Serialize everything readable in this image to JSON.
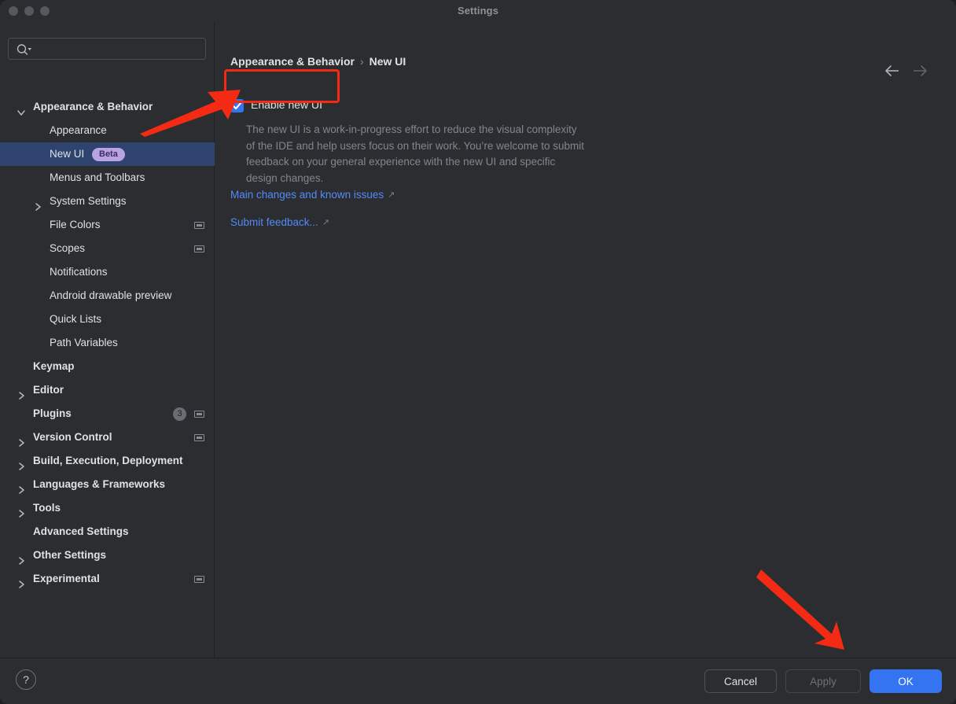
{
  "window": {
    "title": "Settings",
    "traffic_lights": [
      "close",
      "minimize",
      "maximize"
    ]
  },
  "search": {
    "value": "",
    "placeholder": "",
    "icon": "search-icon-with-dropdown"
  },
  "sidebar": {
    "items": [
      {
        "label": "Appearance & Behavior",
        "indent": 0,
        "bold": true,
        "twisty": "expanded",
        "selected": false
      },
      {
        "label": "Appearance",
        "indent": 1,
        "bold": false,
        "twisty": "none",
        "selected": false
      },
      {
        "label": "New UI",
        "indent": 1,
        "bold": false,
        "twisty": "none",
        "selected": true,
        "badge": "Beta"
      },
      {
        "label": "Menus and Toolbars",
        "indent": 1,
        "bold": false,
        "twisty": "none",
        "selected": false
      },
      {
        "label": "System Settings",
        "indent": 1,
        "bold": false,
        "twisty": "collapsed",
        "selected": false
      },
      {
        "label": "File Colors",
        "indent": 1,
        "bold": false,
        "twisty": "none",
        "selected": false,
        "config_icon": true
      },
      {
        "label": "Scopes",
        "indent": 1,
        "bold": false,
        "twisty": "none",
        "selected": false,
        "config_icon": true
      },
      {
        "label": "Notifications",
        "indent": 1,
        "bold": false,
        "twisty": "none",
        "selected": false
      },
      {
        "label": "Android drawable preview",
        "indent": 1,
        "bold": false,
        "twisty": "none",
        "selected": false
      },
      {
        "label": "Quick Lists",
        "indent": 1,
        "bold": false,
        "twisty": "none",
        "selected": false
      },
      {
        "label": "Path Variables",
        "indent": 1,
        "bold": false,
        "twisty": "none",
        "selected": false
      },
      {
        "label": "Keymap",
        "indent": 0,
        "bold": true,
        "twisty": "none",
        "selected": false
      },
      {
        "label": "Editor",
        "indent": 0,
        "bold": true,
        "twisty": "collapsed",
        "selected": false
      },
      {
        "label": "Plugins",
        "indent": 0,
        "bold": true,
        "twisty": "none",
        "selected": false,
        "count": "3",
        "config_icon": true
      },
      {
        "label": "Version Control",
        "indent": 0,
        "bold": true,
        "twisty": "collapsed",
        "selected": false,
        "config_icon": true
      },
      {
        "label": "Build, Execution, Deployment",
        "indent": 0,
        "bold": true,
        "twisty": "collapsed",
        "selected": false
      },
      {
        "label": "Languages & Frameworks",
        "indent": 0,
        "bold": true,
        "twisty": "collapsed",
        "selected": false
      },
      {
        "label": "Tools",
        "indent": 0,
        "bold": true,
        "twisty": "collapsed",
        "selected": false
      },
      {
        "label": "Advanced Settings",
        "indent": 0,
        "bold": true,
        "twisty": "none",
        "selected": false
      },
      {
        "label": "Other Settings",
        "indent": 0,
        "bold": true,
        "twisty": "collapsed",
        "selected": false
      },
      {
        "label": "Experimental",
        "indent": 0,
        "bold": true,
        "twisty": "collapsed",
        "selected": false,
        "config_icon": true
      }
    ]
  },
  "main": {
    "breadcrumb": {
      "parent": "Appearance & Behavior",
      "separator": "›",
      "current": "New UI"
    },
    "nav": {
      "back": "back-arrow",
      "forward": "forward-arrow"
    },
    "checkbox": {
      "label": "Enable new UI",
      "checked": true
    },
    "description": "The new UI is a work-in-progress effort to reduce the visual complexity of the IDE and help users focus on their work. You’re welcome to submit feedback on your general experience with the new UI and specific design changes.",
    "links": [
      {
        "label": "Main changes and known issues",
        "external": "↗"
      },
      {
        "label": "Submit feedback...",
        "external": "↗"
      }
    ]
  },
  "bottom": {
    "help": "?",
    "cancel": "Cancel",
    "apply": "Apply",
    "ok": "OK",
    "apply_enabled": false
  },
  "annotations": {
    "highlight_color": "#f32b15",
    "arrow_color": "#f32b15",
    "arrows": [
      {
        "name": "arrow-to-enable-new-ui-checkbox",
        "direction": "up-right"
      },
      {
        "name": "arrow-to-ok-button",
        "direction": "down-right"
      }
    ]
  },
  "colors": {
    "background": "#2b2d30",
    "selection": "#2e436e",
    "accent": "#3574f0",
    "link": "#548af7",
    "text": "#dfe1e5",
    "muted_text": "#82868d",
    "badge_beta_bg": "#b9a3e3",
    "badge_beta_text": "#3b2d66"
  }
}
